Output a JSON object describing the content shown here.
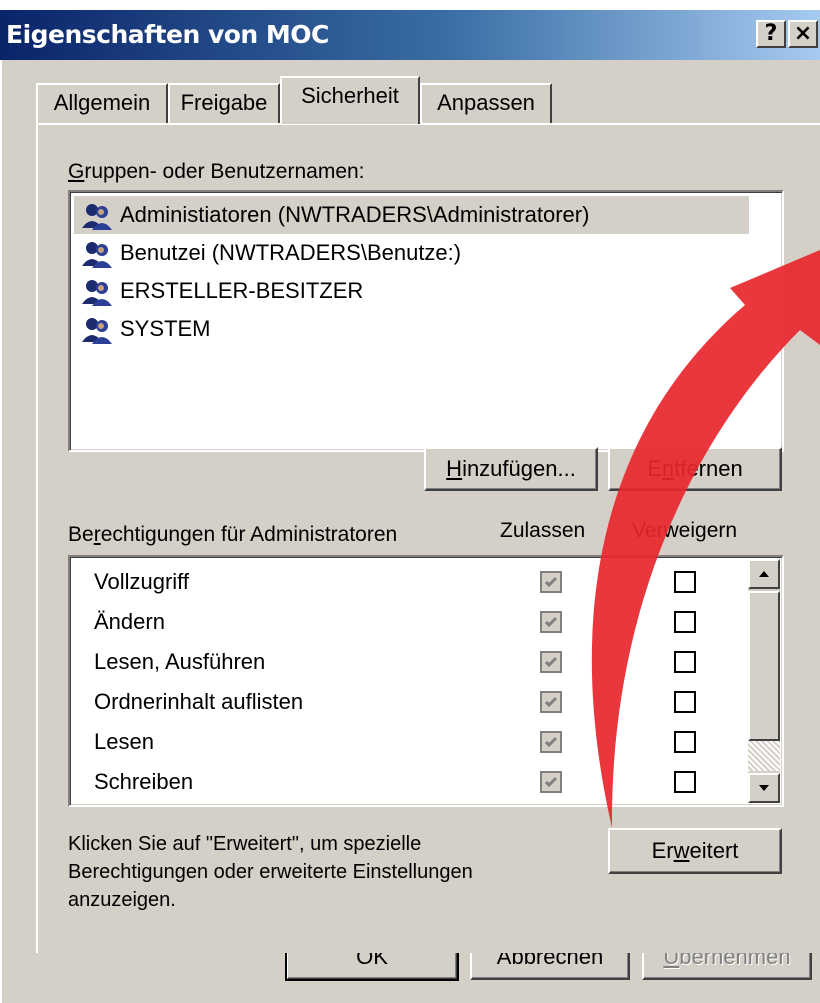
{
  "window": {
    "title": "Eigenschaften von MOC",
    "help_button": "?",
    "close_button": "×"
  },
  "tabs": [
    {
      "label": "Allgemein",
      "active": false
    },
    {
      "label": "Freigabe",
      "active": false
    },
    {
      "label": "Sicherheit",
      "active": true
    },
    {
      "label": "Anpassen",
      "active": false
    }
  ],
  "groups": {
    "label_prefix": "G",
    "label_rest": "ruppen- oder Benutzernamen:",
    "items": [
      {
        "name": "Administiatoren (NWTRADERS\\Administratorer)",
        "icon": "users-group-icon",
        "selected": true
      },
      {
        "name": "Benutzei (NWTRADERS\\Benutze:)",
        "icon": "users-group-icon",
        "selected": false
      },
      {
        "name": "ERSTELLER-BESITZER",
        "icon": "users-group-icon",
        "selected": false
      },
      {
        "name": "SYSTEM",
        "icon": "users-group-icon",
        "selected": false
      }
    ]
  },
  "buttons": {
    "add_u": "H",
    "add_rest": "inzufügen...",
    "remove_pre": "E",
    "remove_u": "n",
    "remove_rest": "tfernen",
    "advanced_pre": "Er",
    "advanced_u": "w",
    "advanced_rest": "eitert",
    "ok": "OK",
    "cancel": "Abbrechen",
    "apply_u": "Ü",
    "apply_rest": "bernehmen"
  },
  "permissions": {
    "header_pre": "Be",
    "header_u": "r",
    "header_rest": "echtigungen für Administratoren",
    "col_allow": "Zulassen",
    "col_deny": "Verweigern",
    "rows": [
      {
        "name": "Vollzugriff",
        "allow": true,
        "deny": false
      },
      {
        "name": "Ändern",
        "allow": true,
        "deny": false
      },
      {
        "name": "Lesen, Ausführen",
        "allow": true,
        "deny": false
      },
      {
        "name": "Ordnerinhalt auflisten",
        "allow": true,
        "deny": false
      },
      {
        "name": "Lesen",
        "allow": true,
        "deny": false
      },
      {
        "name": "Schreiben",
        "allow": true,
        "deny": false
      }
    ]
  },
  "info_text": {
    "line1": "Klicken Sie auf \"Erweitert\", um spezielle",
    "line2": "Berechtigungen oder erweiterte Einstellungen",
    "line3": "anzuzeigen."
  },
  "colors": {
    "dialog_bg": "#d4d0c8",
    "title_start": "#0a246a",
    "title_end": "#a6caf0",
    "annotation_arrow": "#e8262d"
  }
}
